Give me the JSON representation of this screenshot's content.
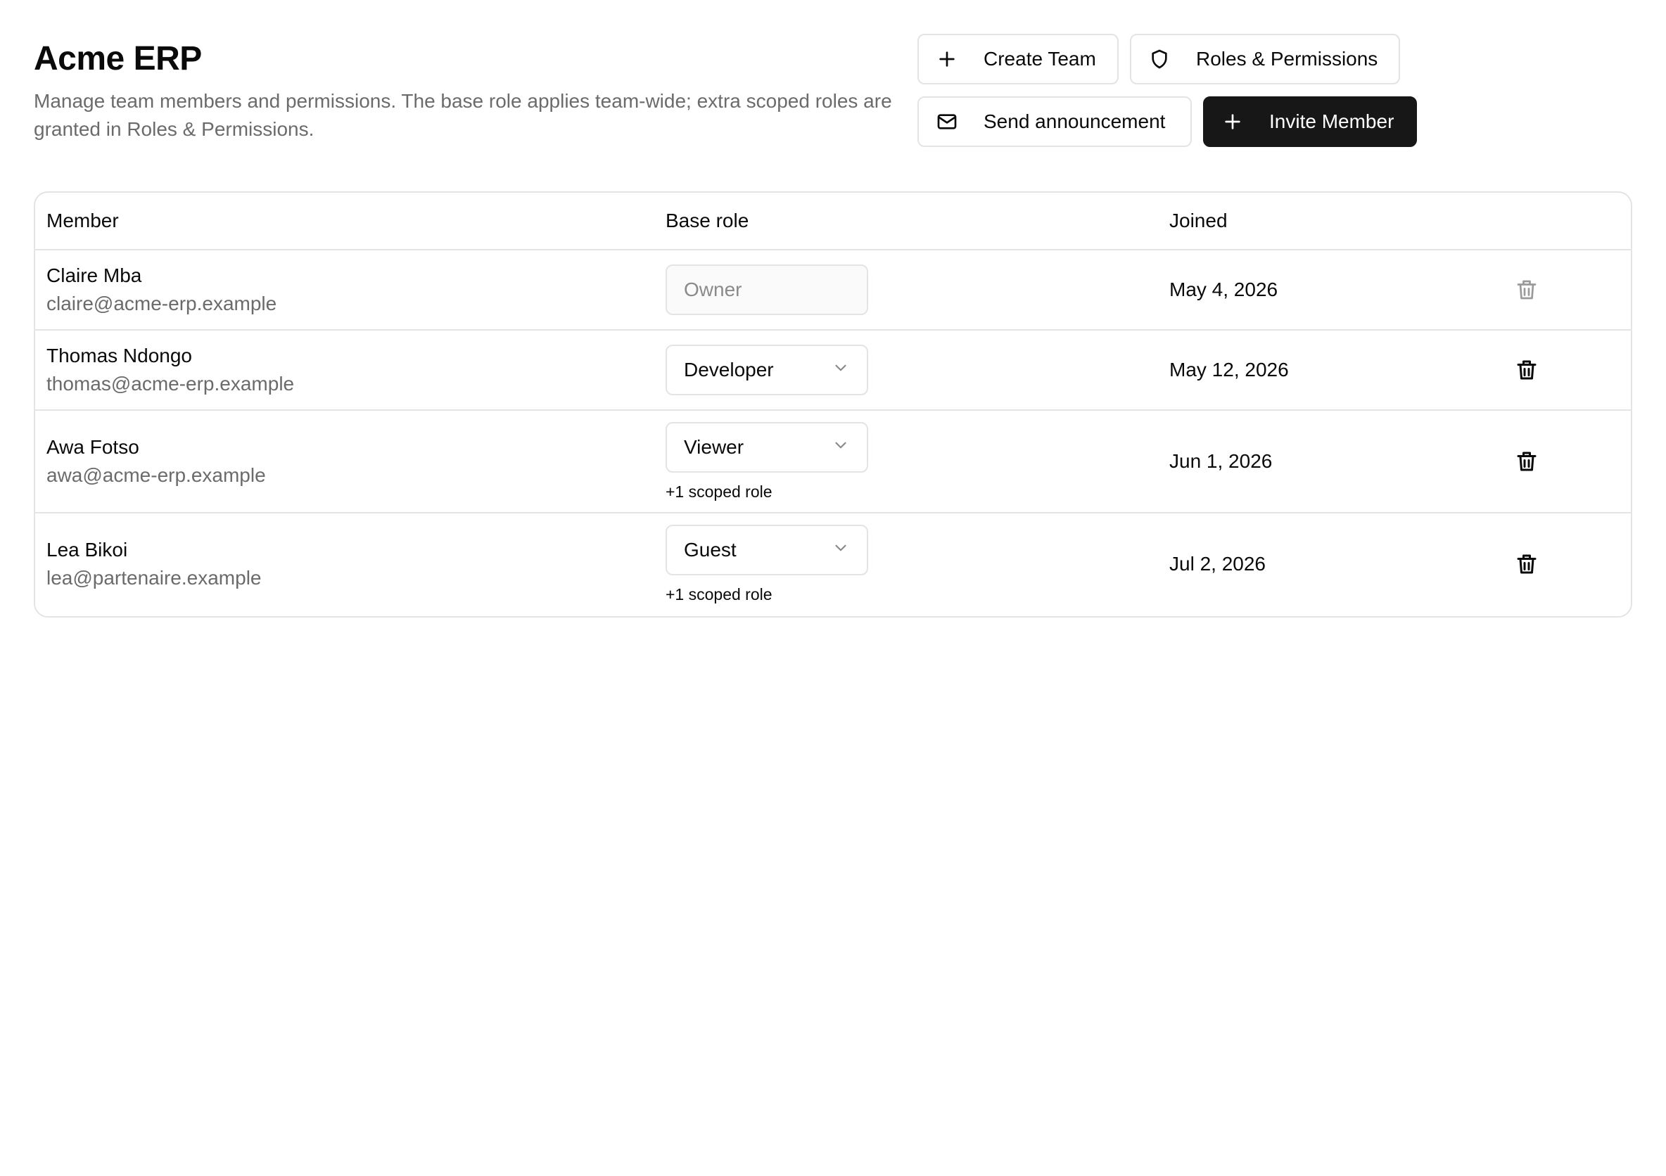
{
  "header": {
    "title": "Acme ERP",
    "description": "Manage team members and permissions. The base role applies team-wide; extra scoped roles are granted in Roles & Permissions."
  },
  "actions": {
    "create_team": "Create Team",
    "roles_permissions": "Roles & Permissions",
    "send_announcement": "Send announcement",
    "invite_member": "Invite Member"
  },
  "table": {
    "columns": {
      "member": "Member",
      "base_role": "Base role",
      "joined": "Joined"
    },
    "rows": [
      {
        "name": "Claire Mba",
        "email": "claire@acme-erp.example",
        "role": "Owner",
        "scoped": "",
        "joined": "May 4, 2026"
      },
      {
        "name": "Thomas Ndongo",
        "email": "thomas@acme-erp.example",
        "role": "Developer",
        "scoped": "",
        "joined": "May 12, 2026"
      },
      {
        "name": "Awa Fotso",
        "email": "awa@acme-erp.example",
        "role": "Viewer",
        "scoped": "+1 scoped role",
        "joined": "Jun 1, 2026"
      },
      {
        "name": "Lea Bikoi",
        "email": "lea@partenaire.example",
        "role": "Guest",
        "scoped": "+1 scoped role",
        "joined": "Jul 2, 2026"
      }
    ]
  },
  "icons": {
    "plus": "plus-icon",
    "shield": "shield-icon",
    "mail": "mail-icon",
    "chevron": "chevron-down-icon",
    "trash": "trash-icon"
  },
  "colors": {
    "primary": "#171717",
    "border": "#e4e4e7",
    "muted_text": "#6b6b6b"
  }
}
